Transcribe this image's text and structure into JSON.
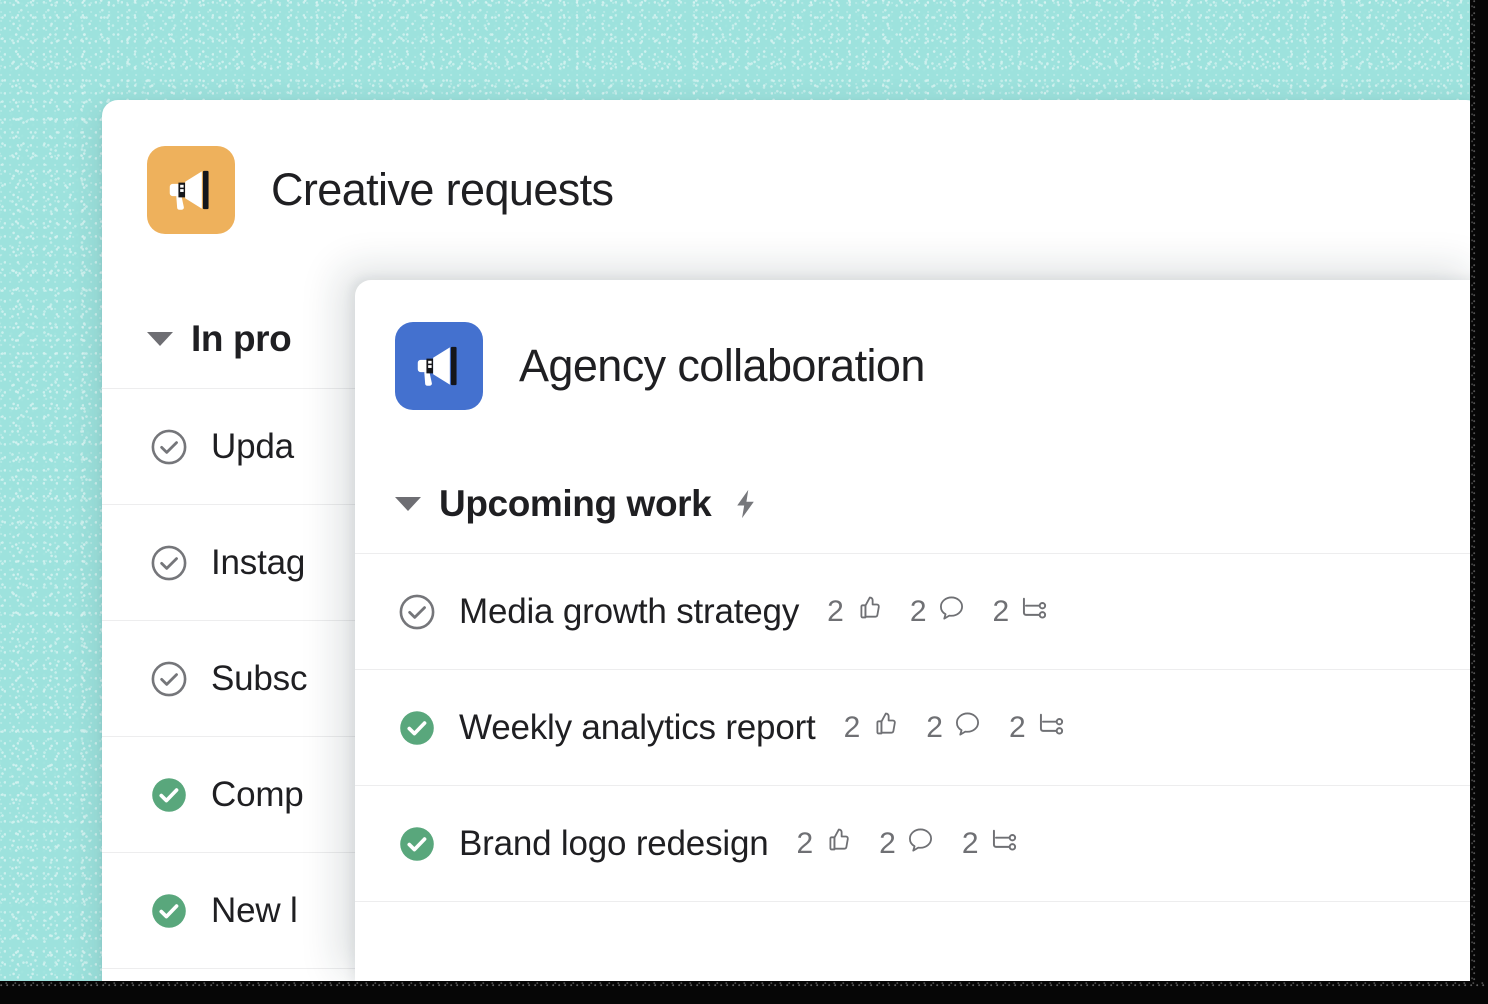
{
  "background": {
    "color": "#9de2dd",
    "texture": "noise-grain"
  },
  "back_card": {
    "icon": "megaphone-icon",
    "icon_color": "#eeb15c",
    "title": "Creative requests",
    "section": {
      "label": "In pro",
      "caret": "caret-down-icon"
    },
    "tasks": [
      {
        "name": "Upda",
        "status": "incomplete",
        "check": "check-circle-outline-icon"
      },
      {
        "name": "Instag",
        "status": "incomplete",
        "check": "check-circle-outline-icon"
      },
      {
        "name": "Subsc",
        "status": "incomplete",
        "check": "check-circle-outline-icon"
      },
      {
        "name": "Comp",
        "status": "complete",
        "check": "check-circle-filled-icon"
      },
      {
        "name": "New l",
        "status": "complete",
        "check": "check-circle-filled-icon"
      }
    ]
  },
  "front_card": {
    "icon": "megaphone-icon",
    "icon_color": "#4471cf",
    "title": "Agency collaboration",
    "section": {
      "label": "Upcoming work",
      "caret": "caret-down-icon",
      "badge_icon": "lightning-bolt-icon"
    },
    "tasks": [
      {
        "name": "Media growth strategy",
        "status": "incomplete",
        "check": "check-circle-outline-icon",
        "likes": "2",
        "comments": "2",
        "subtasks": "2"
      },
      {
        "name": "Weekly analytics report",
        "status": "complete",
        "check": "check-circle-filled-icon",
        "likes": "2",
        "comments": "2",
        "subtasks": "2"
      },
      {
        "name": "Brand logo redesign",
        "status": "complete",
        "check": "check-circle-filled-icon",
        "likes": "2",
        "comments": "2",
        "subtasks": "2"
      }
    ]
  },
  "icons": {
    "like": "thumbs-up-icon",
    "comment": "comment-bubble-icon",
    "subtask": "subtask-branch-icon"
  },
  "colors": {
    "complete_green": "#59a77c",
    "incomplete_gray": "#6f7074",
    "text": "#1f1f22",
    "divider": "#ededee"
  }
}
